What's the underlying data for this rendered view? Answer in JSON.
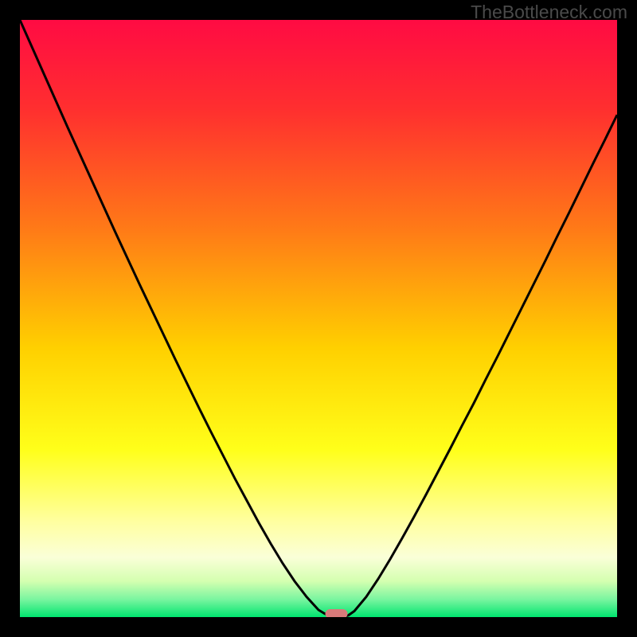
{
  "watermark": "TheBottleneck.com",
  "chart_data": {
    "type": "line",
    "title": "",
    "xlabel": "",
    "ylabel": "",
    "xlim": [
      0,
      1
    ],
    "ylim": [
      0,
      1
    ],
    "background_gradient": {
      "stops": [
        {
          "offset": 0.0,
          "color": "#ff0b43"
        },
        {
          "offset": 0.15,
          "color": "#ff2f2f"
        },
        {
          "offset": 0.35,
          "color": "#ff7a17"
        },
        {
          "offset": 0.55,
          "color": "#ffd000"
        },
        {
          "offset": 0.72,
          "color": "#ffff1a"
        },
        {
          "offset": 0.84,
          "color": "#ffffa0"
        },
        {
          "offset": 0.9,
          "color": "#faffd8"
        },
        {
          "offset": 0.94,
          "color": "#d4ffb0"
        },
        {
          "offset": 0.97,
          "color": "#7bf5a0"
        },
        {
          "offset": 1.0,
          "color": "#00e56f"
        }
      ]
    },
    "curve": {
      "x": [
        0.0,
        0.02,
        0.04,
        0.06,
        0.08,
        0.1,
        0.12,
        0.14,
        0.16,
        0.18,
        0.2,
        0.22,
        0.24,
        0.26,
        0.28,
        0.3,
        0.32,
        0.34,
        0.36,
        0.38,
        0.4,
        0.42,
        0.44,
        0.46,
        0.48,
        0.5,
        0.51,
        0.52,
        0.53,
        0.54,
        0.55,
        0.56,
        0.58,
        0.6,
        0.62,
        0.64,
        0.66,
        0.68,
        0.7,
        0.72,
        0.74,
        0.76,
        0.78,
        0.8,
        0.82,
        0.84,
        0.86,
        0.88,
        0.9,
        0.92,
        0.94,
        0.96,
        0.98,
        1.0
      ],
      "y": [
        1.0,
        0.955,
        0.91,
        0.865,
        0.82,
        0.776,
        0.732,
        0.688,
        0.644,
        0.601,
        0.558,
        0.516,
        0.474,
        0.432,
        0.391,
        0.35,
        0.31,
        0.271,
        0.232,
        0.195,
        0.158,
        0.123,
        0.09,
        0.06,
        0.034,
        0.012,
        0.006,
        0.002,
        0.0,
        0.0,
        0.003,
        0.01,
        0.034,
        0.064,
        0.097,
        0.132,
        0.168,
        0.205,
        0.243,
        0.281,
        0.32,
        0.358,
        0.398,
        0.437,
        0.477,
        0.517,
        0.557,
        0.597,
        0.638,
        0.678,
        0.719,
        0.76,
        0.8,
        0.841
      ]
    },
    "marker": {
      "x": 0.53,
      "y": 0.0,
      "color": "#d87a7a"
    }
  }
}
